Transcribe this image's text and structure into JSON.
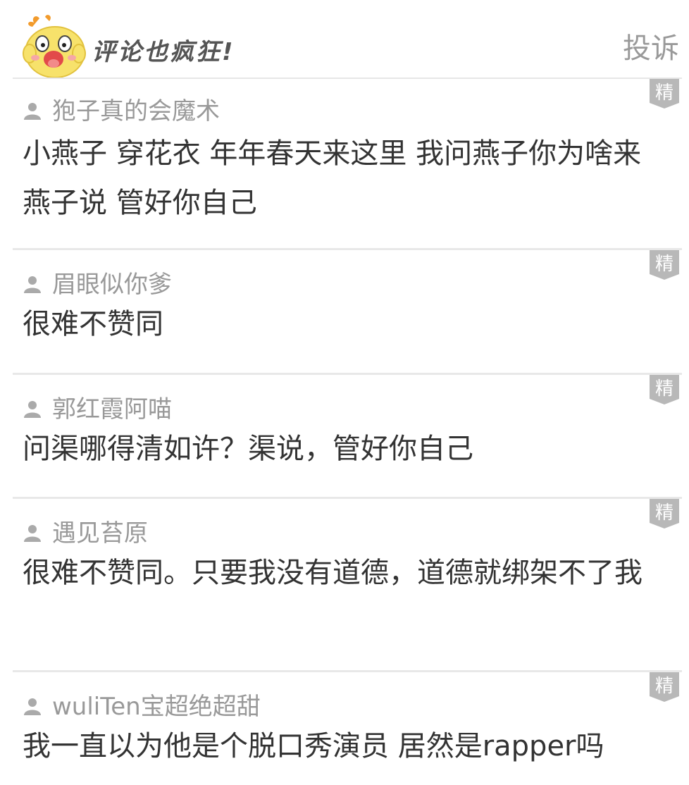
{
  "header": {
    "title": "评论也疯狂!",
    "report_label": "投诉"
  },
  "badge_label": "精",
  "comments": [
    {
      "author": "狍子真的会魔术",
      "text": "小燕子 穿花衣 年年春天来这里 我问燕子你为啥来 燕子说 管好你自己"
    },
    {
      "author": "眉眼似你爹",
      "text": "很难不赞同"
    },
    {
      "author": "郭红霞阿喵",
      "text": "问渠哪得清如许？渠说，管好你自己"
    },
    {
      "author": "遇见苔原",
      "text": "很难不赞同。只要我没有道德，道德就绑架不了我"
    },
    {
      "author": "wuliTen宝超绝超甜",
      "text": "我一直以为他是个脱口秀演员 居然是rapper吗"
    }
  ],
  "colors": {
    "mascot_yellow": "#f7e26b",
    "badge_gray": "#b8b8b8",
    "divider": "#e8e8e8"
  }
}
